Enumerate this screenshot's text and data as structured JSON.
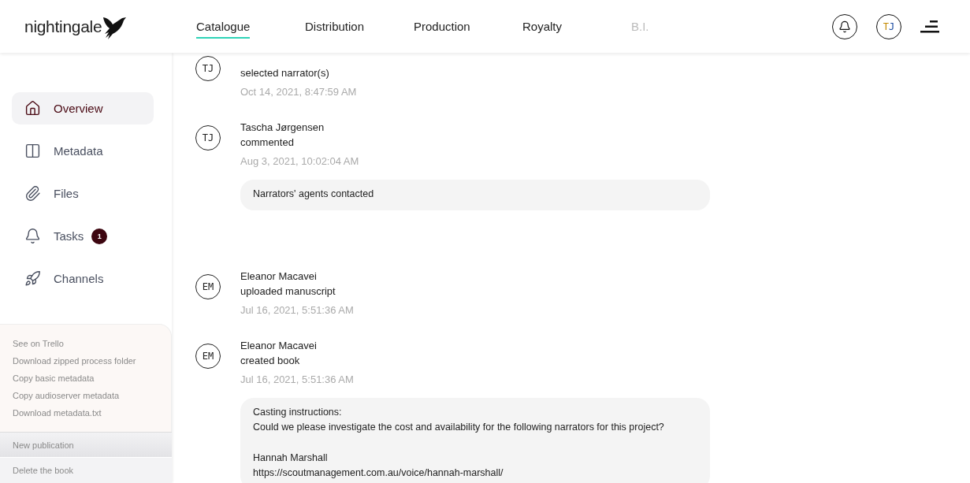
{
  "header": {
    "logo": "nightingale",
    "nav": [
      {
        "label": "Catalogue",
        "selected": true,
        "disabled": false
      },
      {
        "label": "Distribution",
        "selected": false,
        "disabled": false
      },
      {
        "label": "Production",
        "selected": false,
        "disabled": false
      },
      {
        "label": "Royalty",
        "selected": false,
        "disabled": false
      },
      {
        "label": "B.I.",
        "selected": false,
        "disabled": true
      }
    ],
    "user_initials": [
      "T",
      "J"
    ]
  },
  "sidebar": {
    "items": [
      {
        "label": "Overview",
        "selected": true
      },
      {
        "label": "Metadata",
        "selected": false
      },
      {
        "label": "Files",
        "selected": false
      },
      {
        "label": "Tasks",
        "selected": false,
        "badge": "1"
      },
      {
        "label": "Channels",
        "selected": false
      }
    ],
    "actions": [
      "See on Trello",
      "Download zipped process folder",
      "Copy basic metadata",
      "Copy audioserver metadata",
      "Download metadata.txt"
    ],
    "new_publication": "New publication",
    "delete": "Delete the book"
  },
  "activity": [
    {
      "initials": "TJ",
      "action": "selected narrator(s)",
      "time": "Oct 14, 2021, 8:47:59 AM"
    },
    {
      "initials": "TJ",
      "author": "Tascha Jørgensen",
      "action": "commented",
      "time": "Aug 3, 2021, 10:02:04 AM",
      "comment": [
        [
          "Narrators' agents contacted"
        ]
      ]
    },
    {
      "initials": "EM",
      "author": "Eleanor Macavei",
      "action": "uploaded manuscript",
      "time": "Jul 16, 2021, 5:51:36 AM"
    },
    {
      "initials": "EM",
      "author": "Eleanor Macavei",
      "action": "created book",
      "time": "Jul 16, 2021, 5:51:36 AM",
      "comment": [
        [
          "Casting instructions:",
          "Could we please investigate the cost and availability for the following narrators for this project?"
        ],
        [
          "Hannah Marshall",
          "https://scoutmanagement.com.au/voice/hannah-marshall/"
        ]
      ]
    }
  ]
}
